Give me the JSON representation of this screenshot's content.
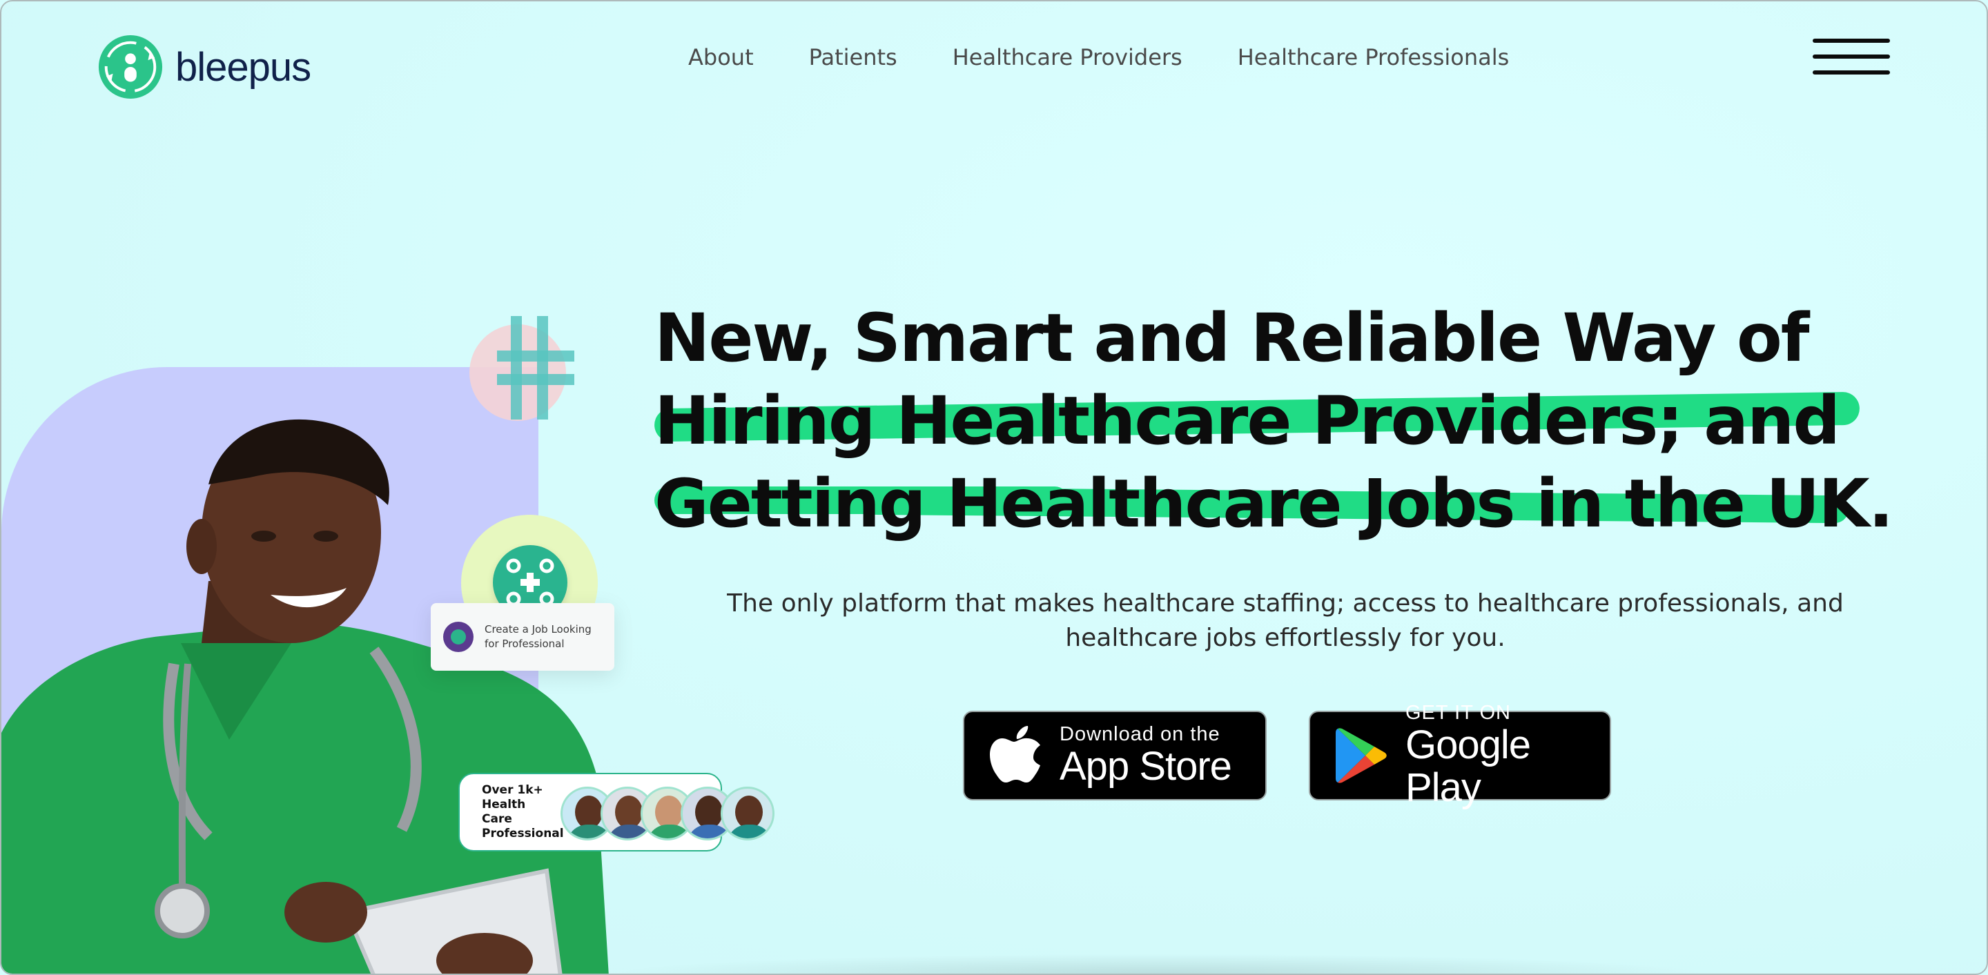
{
  "brand": {
    "name": "bleepus",
    "color": "#2bc48a",
    "text_color": "#10214a"
  },
  "nav": {
    "items": [
      {
        "label": "About"
      },
      {
        "label": "Patients"
      },
      {
        "label": "Healthcare Providers"
      },
      {
        "label": "Healthcare Professionals"
      }
    ],
    "menu_icon": "hamburger-menu-icon"
  },
  "hero": {
    "title_lines": [
      "New, Smart and Reliable Way of",
      "Hiring Healthcare Providers; and",
      "Getting Healthcare Jobs in the UK."
    ],
    "highlight_color": "#20dc85",
    "subtitle_lines": [
      "The only platform that makes healthcare staffing; access to healthcare professionals, and",
      "healthcare jobs effortlessly for you."
    ]
  },
  "stores": {
    "apple": {
      "small": "Download on the",
      "big": "App Store",
      "icon": "apple-logo-icon"
    },
    "google": {
      "small": "GET IT ON",
      "big": "Google Play",
      "icon": "google-play-logo-icon"
    }
  },
  "illustration": {
    "job_card_text": "Create a Job Looking for Professional",
    "pro_card_text": "Over 1k+ Health Care Professional",
    "panel_color": "#c7ccfd"
  },
  "colors": {
    "background": "#d6fdfd",
    "accent_green": "#20dc85"
  }
}
